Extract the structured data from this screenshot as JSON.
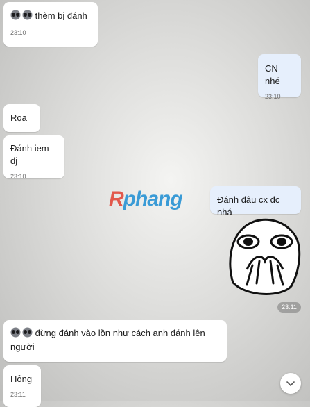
{
  "messages": [
    {
      "id": "m1",
      "text": "thèm bị đánh",
      "time": "23:10",
      "emoji": "alien-alien"
    },
    {
      "id": "m2",
      "text": "CN nhé",
      "time": "23:10"
    },
    {
      "id": "m3",
      "text": "Rọa"
    },
    {
      "id": "m4",
      "text": "Đánh iem dj",
      "time": "23:10"
    },
    {
      "id": "m5",
      "text": "Đánh đâu cx đc nhá"
    },
    {
      "id": "m6",
      "time": "23:11",
      "sticker": "covering-mouth-face-sticker"
    },
    {
      "id": "m7",
      "text": "đừng đánh vào lồn như cách anh đánh lên người",
      "emoji": "alien-alien"
    },
    {
      "id": "m8",
      "text": "Hỏng",
      "time": "23:11"
    }
  ],
  "watermark": {
    "part1": "R",
    "part2": "phang"
  },
  "colors": {
    "incoming": "#ffffff",
    "outgoing": "#e6effc",
    "watermark_red": "#e2584b",
    "watermark_blue": "#3a9bd6"
  },
  "icons": {
    "scroll_down": "chevron-down-icon",
    "emoji": "alien-face-icon"
  }
}
